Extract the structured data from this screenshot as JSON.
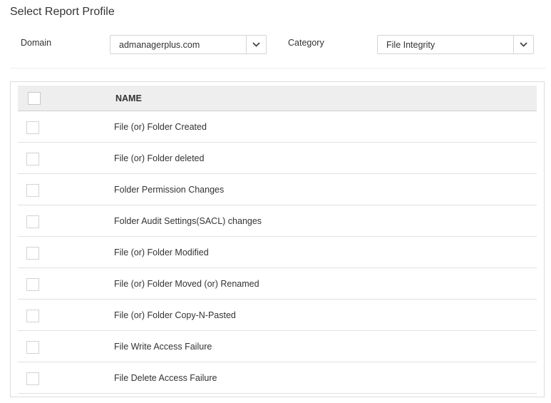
{
  "page": {
    "title": "Select Report Profile"
  },
  "filters": {
    "domain": {
      "label": "Domain",
      "value": "admanagerplus.com"
    },
    "category": {
      "label": "Category",
      "value": "File Integrity"
    }
  },
  "table": {
    "column_name": "NAME",
    "rows": [
      {
        "name": "File (or) Folder Created"
      },
      {
        "name": "File (or) Folder deleted"
      },
      {
        "name": "Folder Permission Changes"
      },
      {
        "name": "Folder Audit Settings(SACL) changes"
      },
      {
        "name": "File (or) Folder Modified"
      },
      {
        "name": "File (or) Folder Moved (or) Renamed"
      },
      {
        "name": "File (or) Folder Copy-N-Pasted"
      },
      {
        "name": "File Write Access Failure"
      },
      {
        "name": "File Delete Access Failure"
      }
    ]
  },
  "icons": {
    "dropdown": "chevron-down-icon"
  },
  "colors": {
    "header_bg": "#eeeeee",
    "border": "#dddddd",
    "text": "#333333"
  }
}
